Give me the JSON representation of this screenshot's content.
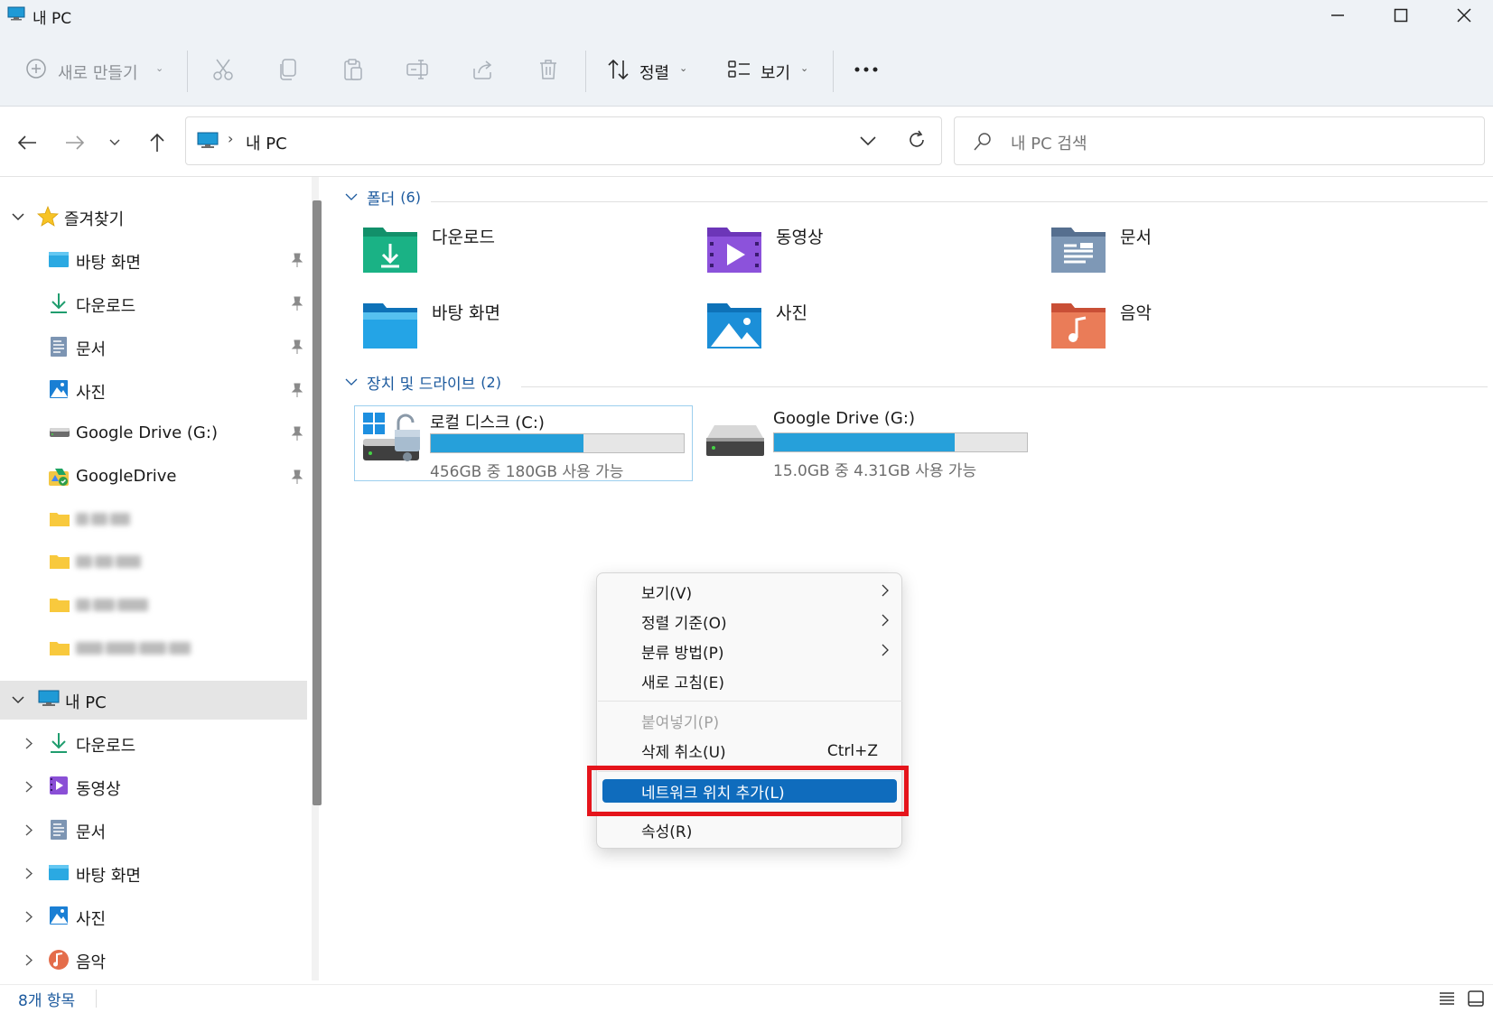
{
  "window": {
    "title": "내 PC",
    "controls": [
      "minimize-icon",
      "maximize-icon",
      "close-icon"
    ]
  },
  "toolbar": {
    "new_label": "새로 만들기",
    "sort_label": "정렬",
    "view_label": "보기",
    "icons": [
      "cut-icon",
      "copy-icon",
      "paste-icon",
      "rename-icon",
      "share-icon",
      "delete-icon",
      "more-icon"
    ]
  },
  "address": {
    "path": "내 PC",
    "search_placeholder": "내 PC 검색"
  },
  "sidebar": {
    "favorites_label": "즐겨찾기",
    "favorites": [
      {
        "label": "바탕 화면",
        "icon": "desktop-icon",
        "pinned": true
      },
      {
        "label": "다운로드",
        "icon": "download-icon",
        "pinned": true
      },
      {
        "label": "문서",
        "icon": "document-icon",
        "pinned": true
      },
      {
        "label": "사진",
        "icon": "pictures-icon",
        "pinned": true
      },
      {
        "label": "Google Drive (G:)",
        "icon": "drive-icon",
        "pinned": true
      },
      {
        "label": "GoogleDrive",
        "icon": "google-drive-icon",
        "pinned": true
      }
    ],
    "this_pc_label": "내 PC",
    "this_pc_items": [
      {
        "label": "다운로드",
        "icon": "download-icon"
      },
      {
        "label": "동영상",
        "icon": "videos-icon"
      },
      {
        "label": "문서",
        "icon": "document-icon"
      },
      {
        "label": "바탕 화면",
        "icon": "desktop-icon"
      },
      {
        "label": "사진",
        "icon": "pictures-icon"
      },
      {
        "label": "음악",
        "icon": "music-icon"
      }
    ]
  },
  "content": {
    "folders_header": "폴더",
    "folders_count": "(6)",
    "folders": [
      {
        "name": "다운로드",
        "icon": "downloads-folder-icon",
        "color": "#1aa37a"
      },
      {
        "name": "동영상",
        "icon": "videos-folder-icon",
        "color": "#8a4fd6"
      },
      {
        "name": "문서",
        "icon": "documents-folder-icon",
        "color": "#6b8bb0"
      },
      {
        "name": "바탕 화면",
        "icon": "desktop-folder-icon",
        "color": "#1c8fd8"
      },
      {
        "name": "사진",
        "icon": "pictures-folder-icon",
        "color": "#1c8fd8"
      },
      {
        "name": "음악",
        "icon": "music-folder-icon",
        "color": "#e46d4b"
      }
    ],
    "drives_header": "장치 및 드라이브",
    "drives_count": "(2)",
    "drives": [
      {
        "name": "로컬 디스크 (C:)",
        "space": "456GB 중 180GB 사용 가능",
        "used_fraction": 0.605,
        "icon": "system-drive-icon"
      },
      {
        "name": "Google Drive (G:)",
        "space": "15.0GB 중 4.31GB 사용 가능",
        "used_fraction": 0.713,
        "icon": "drive-icon"
      }
    ]
  },
  "context_menu": {
    "view": "보기(V)",
    "sort_by": "정렬 기준(O)",
    "group_by": "분류 방법(P)",
    "refresh": "새로 고침(E)",
    "paste": "붙여넣기(P)",
    "undo_delete": "삭제 취소(U)",
    "undo_shortcut": "Ctrl+Z",
    "add_network_location": "네트워크 위치 추가(L)",
    "properties": "속성(R)"
  },
  "status": {
    "item_count": "8개 항목"
  },
  "colors": {
    "accent": "#0f6cbd",
    "highlight_box": "#e5141b",
    "drive_bar": "#26a0da",
    "header_text": "#1c5a9e"
  }
}
